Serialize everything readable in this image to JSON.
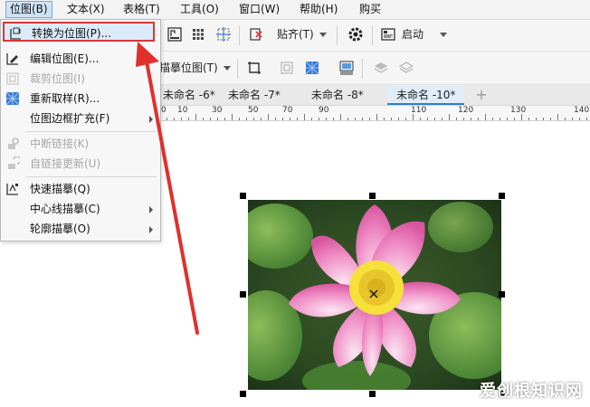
{
  "menubar": {
    "items": [
      {
        "label": "位图(B)"
      },
      {
        "label": "文本(X)"
      },
      {
        "label": "表格(T)"
      },
      {
        "label": "工具(O)"
      },
      {
        "label": "窗口(W)"
      },
      {
        "label": "帮助(H)"
      },
      {
        "label": "购买"
      }
    ]
  },
  "toolbar1": {
    "align_label": "贴齐(T)",
    "launch_label": "启动"
  },
  "toolbar2": {
    "trace_label": "描摹位图(T)"
  },
  "tabs": [
    {
      "label": "未命名 -6*"
    },
    {
      "label": "未命名 -7*"
    },
    {
      "label": "未命名 -8*"
    },
    {
      "label": "未命名 -10*"
    }
  ],
  "ruler": {
    "labels": [
      "0",
      "10",
      "30",
      "50",
      "70",
      "90",
      "110",
      "120",
      "130",
      "140"
    ]
  },
  "bitmap_menu": {
    "items": [
      {
        "label": "转换为位图(P)...",
        "enabled": true
      },
      {
        "label": "编辑位图(E)...",
        "enabled": true
      },
      {
        "label": "裁剪位图(I)",
        "enabled": false
      },
      {
        "label": "重新取样(R)...",
        "enabled": true
      },
      {
        "label": "位图边框扩充(F)",
        "enabled": true,
        "submenu": true
      },
      {
        "label": "中断链接(K)",
        "enabled": false
      },
      {
        "label": "自链接更新(U)",
        "enabled": false
      },
      {
        "label": "快速描摹(Q)",
        "enabled": true
      },
      {
        "label": "中心线描摹(C)",
        "enabled": true,
        "submenu": true
      },
      {
        "label": "轮廓描摹(O)",
        "enabled": true,
        "submenu": true
      }
    ]
  },
  "watermark": "爱创根知识网",
  "colors": {
    "highlight_border": "#d9363a",
    "menu_highlight": "#dcebfa",
    "tab_accent": "#2f7fd1"
  }
}
